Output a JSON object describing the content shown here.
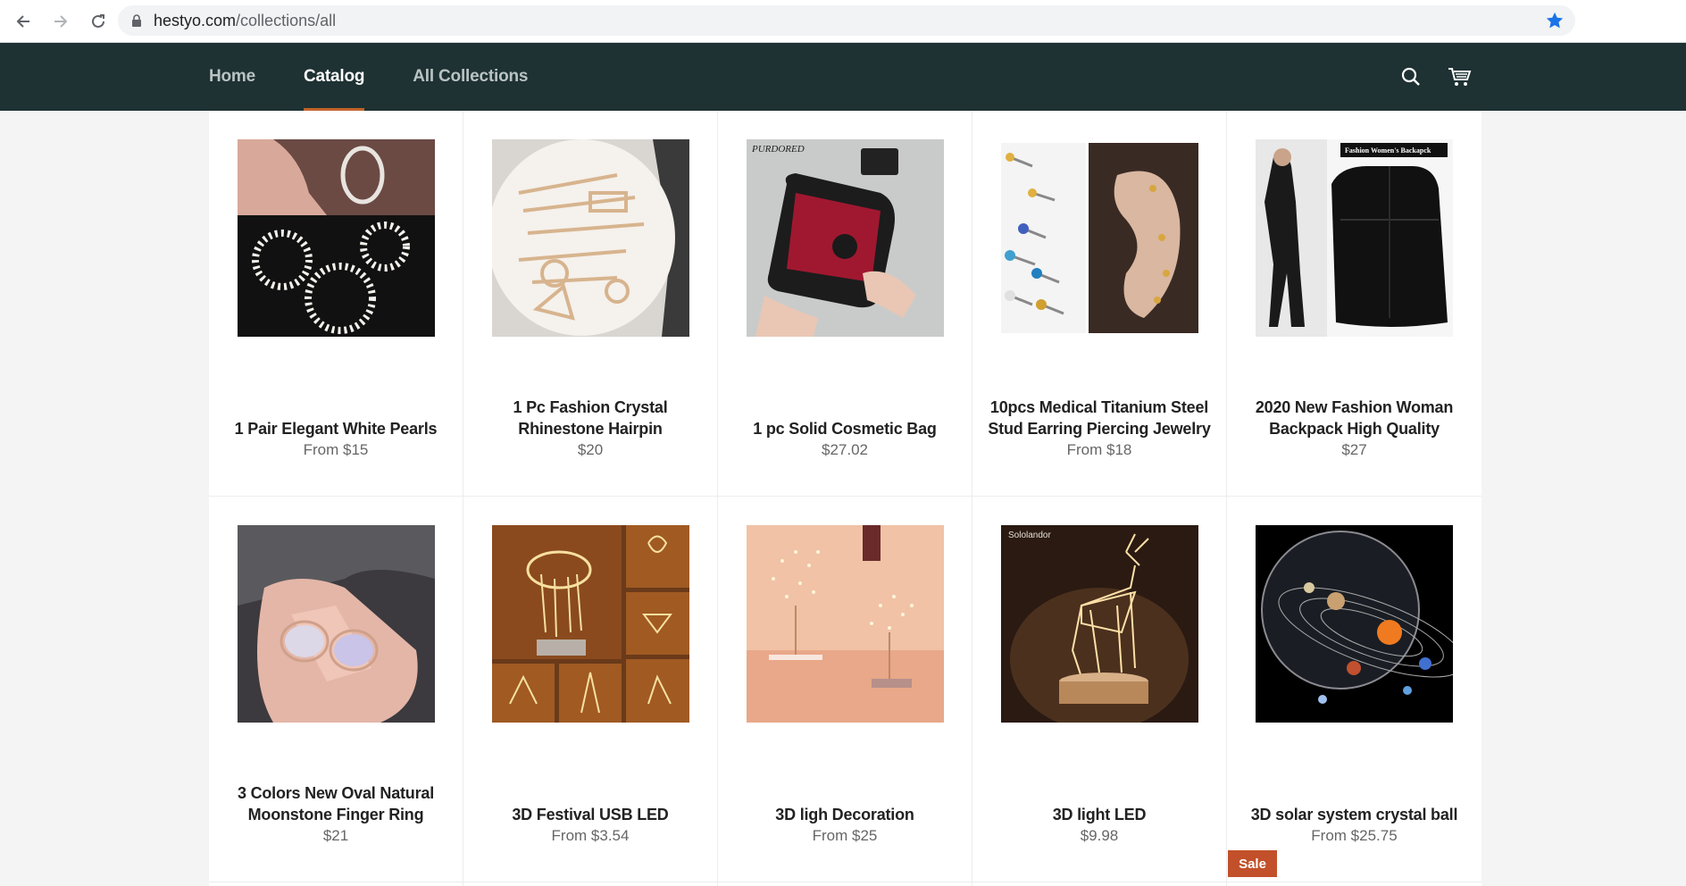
{
  "browser": {
    "url_host": "hestyo.com",
    "url_path": "/collections/all"
  },
  "nav": {
    "items": [
      {
        "label": "Home",
        "active": false
      },
      {
        "label": "Catalog",
        "active": true
      },
      {
        "label": "All Collections",
        "active": false
      }
    ]
  },
  "colors": {
    "header_bg": "#1e3133",
    "accent": "#c2642c",
    "sale": "#c2502a"
  },
  "products": [
    {
      "title": "1 Pair Elegant White Pearls",
      "price": "From $15",
      "image": "pearl-hoop-earrings"
    },
    {
      "title": "1 Pc Fashion Crystal Rhinestone Hairpin",
      "price": "$20",
      "image": "crystal-hairpins"
    },
    {
      "title": "1 pc Solid Cosmetic Bag",
      "price": "$27.02",
      "image": "cosmetic-bag",
      "image_text": "PURDORED"
    },
    {
      "title": "10pcs Medical Titanium Steel Stud Earring Piercing Jewelry",
      "price": "From $18",
      "image": "stud-earrings"
    },
    {
      "title": "2020 New Fashion Woman Backpack High Quality",
      "price": "$27",
      "image": "leather-backpack",
      "image_text": "Fashion Women's Backapck"
    },
    {
      "title": "3 Colors New Oval Natural Moonstone Finger Ring",
      "price": "$21",
      "image": "moonstone-ring"
    },
    {
      "title": "3D Festival USB LED",
      "price": "From $3.54",
      "image": "led-lamps-collage"
    },
    {
      "title": "3D ligh Decoration",
      "price": "From $25",
      "image": "tree-lights"
    },
    {
      "title": "3D light LED",
      "price": "$9.98",
      "image": "deer-lamp",
      "image_text": "Sololandor"
    },
    {
      "title": "3D solar system crystal ball",
      "price": "From $25.75",
      "image": "solar-system-ball"
    }
  ],
  "sale_badge": "Sale"
}
